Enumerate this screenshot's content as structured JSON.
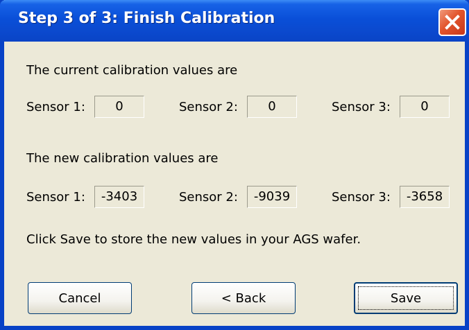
{
  "window": {
    "title": "Step 3 of 3: Finish Calibration",
    "title_bar_color": "#0a4fd8",
    "close_icon": "close-x-icon"
  },
  "current": {
    "heading": "The current calibration values are",
    "sensors": [
      {
        "label": "Sensor 1:",
        "value": "0"
      },
      {
        "label": "Sensor 2:",
        "value": "0"
      },
      {
        "label": "Sensor 3:",
        "value": "0"
      }
    ]
  },
  "new": {
    "heading": "The new calibration values are",
    "sensors": [
      {
        "label": "Sensor 1:",
        "value": "-3403"
      },
      {
        "label": "Sensor 2:",
        "value": "-9039"
      },
      {
        "label": "Sensor 3:",
        "value": "-3658"
      }
    ]
  },
  "instruction": "Click Save to store the new values in your AGS wafer.",
  "buttons": {
    "cancel": "Cancel",
    "back": "< Back",
    "save": "Save"
  }
}
